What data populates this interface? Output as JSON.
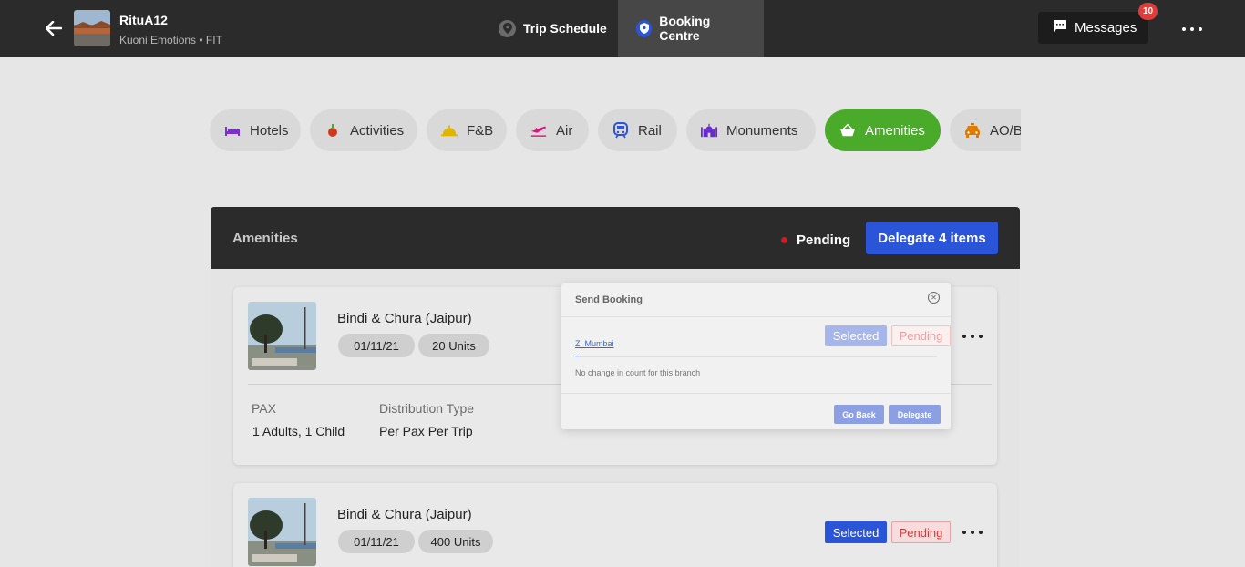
{
  "header": {
    "trip_name": "RituA12",
    "trip_subtitle": "Kuoni Emotions • FIT",
    "tabs": [
      {
        "label": "Trip Schedule",
        "icon": "location-pin-icon"
      },
      {
        "label": "Booking Centre",
        "icon": "shield-icon"
      }
    ],
    "messages_label": "Messages",
    "messages_count": "10"
  },
  "categories": [
    {
      "label": "Hotels",
      "icon": "bed-icon",
      "color": "#7b2fd1"
    },
    {
      "label": "Activities",
      "icon": "activity-icon",
      "color": "#d03a1a"
    },
    {
      "label": "F&B",
      "icon": "cloche-icon",
      "color": "#e0b400"
    },
    {
      "label": "Air",
      "icon": "plane-icon",
      "color": "#d81b7a"
    },
    {
      "label": "Rail",
      "icon": "train-icon",
      "color": "#2b55d9"
    },
    {
      "label": "Monuments",
      "icon": "monument-icon",
      "color": "#6a2ad1"
    },
    {
      "label": "Amenities",
      "icon": "basket-icon",
      "color": "#ffffff"
    },
    {
      "label": "AO/B",
      "icon": "car-icon",
      "color": "#e07a00"
    }
  ],
  "panel": {
    "title": "Amenities",
    "status": "Pending",
    "delegate_label": "Delegate 4 items"
  },
  "items": [
    {
      "title": "Bindi & Chura (Jaipur)",
      "date": "01/11/21",
      "units": "20 Units",
      "pax_label": "PAX",
      "pax_value": "1 Adults, 1 Child",
      "dist_label": "Distribution Type",
      "dist_value": "Per Pax Per Trip"
    },
    {
      "title": "Bindi & Chura (Jaipur)",
      "date": "01/11/21",
      "units": "400 Units",
      "selected_label": "Selected",
      "pending_label": "Pending"
    }
  ],
  "modal": {
    "title": "Send Booking",
    "branch": "Z_Mumbai",
    "note": "No change in count for this branch",
    "selected_label": "Selected",
    "pending_label": "Pending",
    "go_back_label": "Go Back",
    "delegate_label": "Delegate"
  }
}
